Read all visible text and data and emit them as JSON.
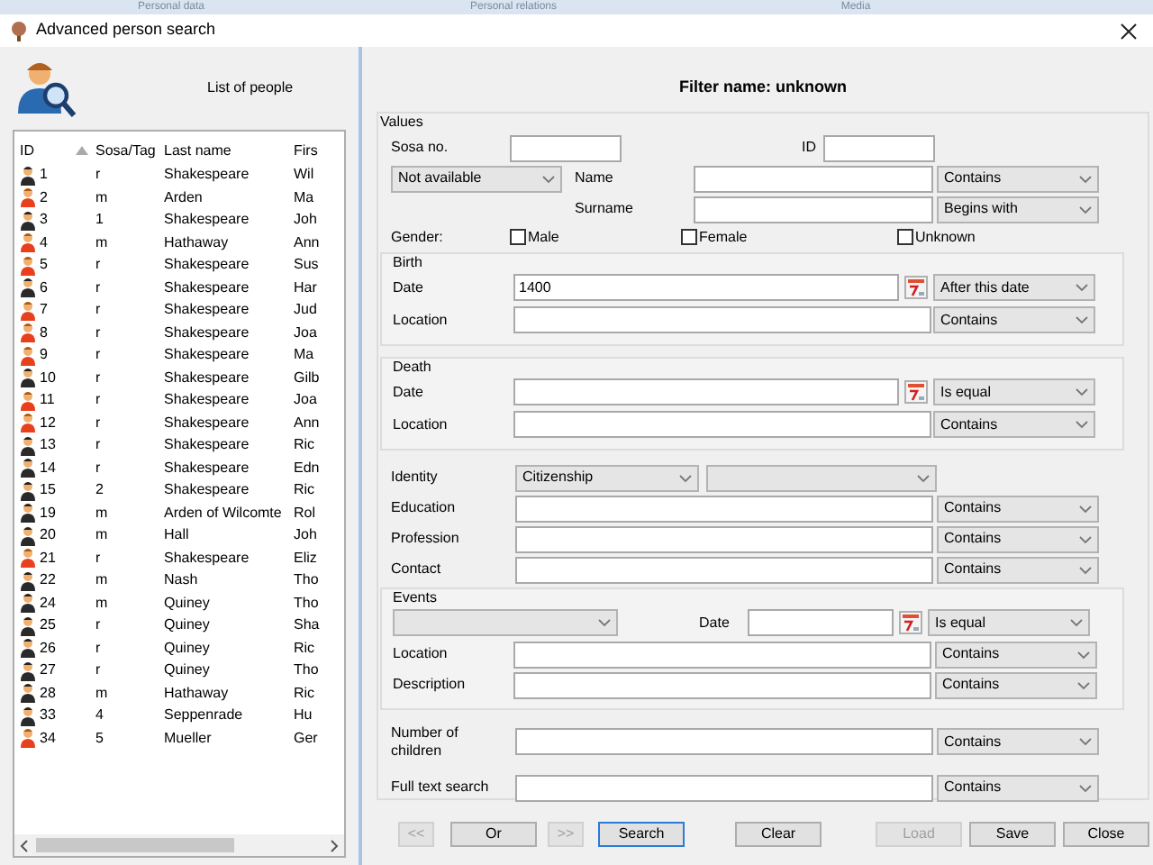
{
  "background_tabs": [
    "Personal data",
    "Personal relations",
    "Media"
  ],
  "window": {
    "title": "Advanced person search"
  },
  "list": {
    "title": "List of people",
    "columns": [
      {
        "label": "ID",
        "sorted": true
      },
      {
        "label": "Sosa/Tag",
        "sorted": false
      },
      {
        "label": "Last name",
        "sorted": false
      },
      {
        "label": "Firs",
        "sorted": false
      }
    ],
    "rows": [
      {
        "id": "1",
        "sosa": "r",
        "last_name": "Shakespeare",
        "first_name": "Wil",
        "kind": "male"
      },
      {
        "id": "2",
        "sosa": "m",
        "last_name": "Arden",
        "first_name": "Ma",
        "kind": "female"
      },
      {
        "id": "3",
        "sosa": "1",
        "last_name": "Shakespeare",
        "first_name": "Joh",
        "kind": "male"
      },
      {
        "id": "4",
        "sosa": "m",
        "last_name": "Hathaway",
        "first_name": "Ann",
        "kind": "female"
      },
      {
        "id": "5",
        "sosa": "r",
        "last_name": "Shakespeare",
        "first_name": "Sus",
        "kind": "female"
      },
      {
        "id": "6",
        "sosa": "r",
        "last_name": "Shakespeare",
        "first_name": "Har",
        "kind": "male"
      },
      {
        "id": "7",
        "sosa": "r",
        "last_name": "Shakespeare",
        "first_name": "Jud",
        "kind": "female"
      },
      {
        "id": "8",
        "sosa": "r",
        "last_name": "Shakespeare",
        "first_name": "Joa",
        "kind": "female"
      },
      {
        "id": "9",
        "sosa": "r",
        "last_name": "Shakespeare",
        "first_name": "Ma",
        "kind": "female"
      },
      {
        "id": "10",
        "sosa": "r",
        "last_name": "Shakespeare",
        "first_name": "Gilb",
        "kind": "male"
      },
      {
        "id": "11",
        "sosa": "r",
        "last_name": "Shakespeare",
        "first_name": "Joa",
        "kind": "female"
      },
      {
        "id": "12",
        "sosa": "r",
        "last_name": "Shakespeare",
        "first_name": "Ann",
        "kind": "female"
      },
      {
        "id": "13",
        "sosa": "r",
        "last_name": "Shakespeare",
        "first_name": "Ric",
        "kind": "male"
      },
      {
        "id": "14",
        "sosa": "r",
        "last_name": "Shakespeare",
        "first_name": "Edn",
        "kind": "male"
      },
      {
        "id": "15",
        "sosa": "2",
        "last_name": "Shakespeare",
        "first_name": "Ric",
        "kind": "male"
      },
      {
        "id": "19",
        "sosa": "m",
        "last_name": "Arden of Wilcomte",
        "first_name": "Rol",
        "kind": "male"
      },
      {
        "id": "20",
        "sosa": "m",
        "last_name": "Hall",
        "first_name": "Joh",
        "kind": "male"
      },
      {
        "id": "21",
        "sosa": "r",
        "last_name": "Shakespeare",
        "first_name": "Eliz",
        "kind": "female"
      },
      {
        "id": "22",
        "sosa": "m",
        "last_name": "Nash",
        "first_name": "Tho",
        "kind": "male"
      },
      {
        "id": "24",
        "sosa": "m",
        "last_name": "Quiney",
        "first_name": "Tho",
        "kind": "male"
      },
      {
        "id": "25",
        "sosa": "r",
        "last_name": "Quiney",
        "first_name": "Sha",
        "kind": "male"
      },
      {
        "id": "26",
        "sosa": "r",
        "last_name": "Quiney",
        "first_name": "Ric",
        "kind": "male"
      },
      {
        "id": "27",
        "sosa": "r",
        "last_name": "Quiney",
        "first_name": "Tho",
        "kind": "male"
      },
      {
        "id": "28",
        "sosa": "m",
        "last_name": "Hathaway",
        "first_name": "Ric",
        "kind": "male"
      },
      {
        "id": "33",
        "sosa": "4",
        "last_name": "Seppenrade",
        "first_name": "Hu",
        "kind": "male"
      },
      {
        "id": "34",
        "sosa": "5",
        "last_name": "Mueller",
        "first_name": "Ger",
        "kind": "female"
      }
    ]
  },
  "filter": {
    "title": "Filter name: unknown",
    "group_label": "Values",
    "sosa_label": "Sosa no.",
    "id_label": "ID",
    "name_mode": "Not available",
    "name_label": "Name",
    "name_op": "Contains",
    "surname_label": "Surname",
    "surname_op": "Begins with",
    "gender_label": "Gender:",
    "gender_options": [
      {
        "label": "Male",
        "checked": false
      },
      {
        "label": "Female",
        "checked": false
      },
      {
        "label": "Unknown",
        "checked": false
      }
    ],
    "birth": {
      "label": "Birth",
      "date_label": "Date",
      "date_value": "1400",
      "date_op": "After this date",
      "location_label": "Location",
      "location_op": "Contains"
    },
    "death": {
      "label": "Death",
      "date_label": "Date",
      "date_op": "Is equal",
      "location_label": "Location",
      "location_op": "Contains"
    },
    "identity": {
      "label": "Identity",
      "type": "Citizenship"
    },
    "fields": [
      {
        "label": "Education",
        "op": "Contains"
      },
      {
        "label": "Profession",
        "op": "Contains"
      },
      {
        "label": "Contact",
        "op": "Contains"
      }
    ],
    "events": {
      "label": "Events",
      "date_label": "Date",
      "date_op": "Is equal",
      "location_label": "Location",
      "location_op": "Contains",
      "description_label": "Description",
      "description_op": "Contains"
    },
    "children": {
      "label": "Number of children",
      "op": "Contains"
    },
    "fulltext": {
      "label": "Full text search",
      "op": "Contains"
    }
  },
  "buttons": [
    {
      "label": "<<",
      "disabled": true,
      "default": false
    },
    {
      "label": "Or",
      "disabled": false,
      "default": false
    },
    {
      "label": ">>",
      "disabled": true,
      "default": false
    },
    {
      "label": "Search",
      "disabled": false,
      "default": true
    },
    {
      "label": "Clear",
      "disabled": false,
      "default": false
    },
    {
      "label": "Load",
      "disabled": true,
      "default": false
    },
    {
      "label": "Save",
      "disabled": false,
      "default": false
    },
    {
      "label": "Close",
      "disabled": false,
      "default": false
    }
  ]
}
